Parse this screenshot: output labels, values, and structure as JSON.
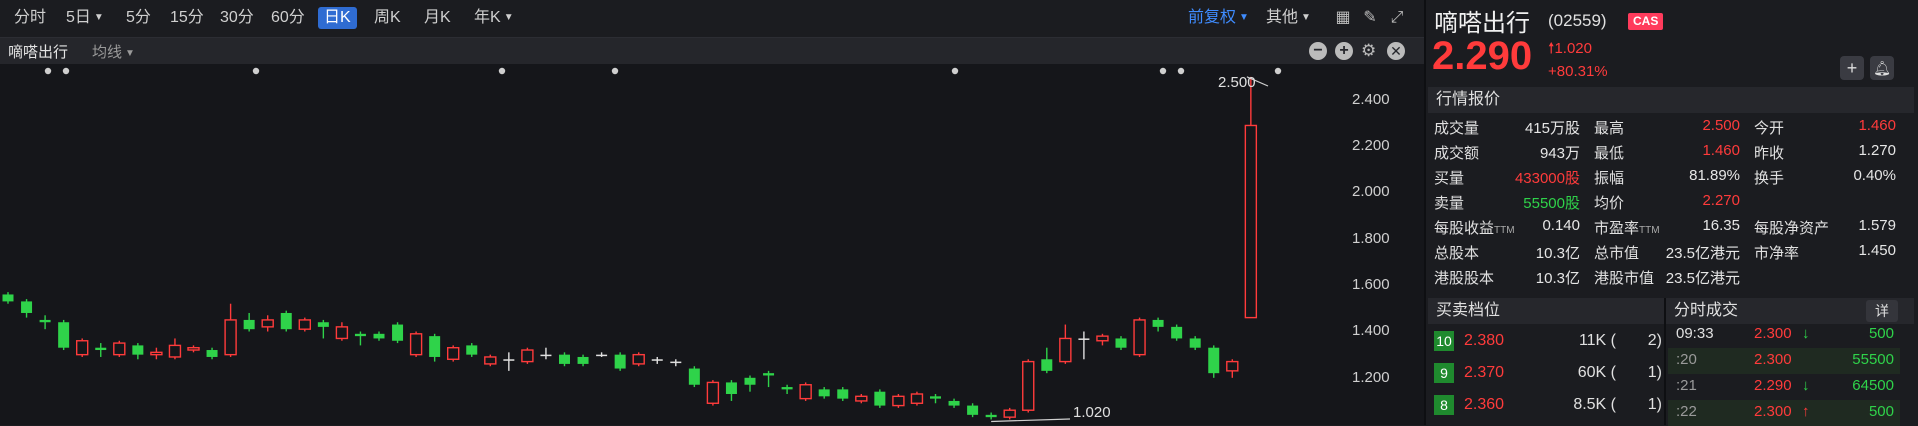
{
  "toolbar": {
    "periods": [
      "分时",
      "5日",
      "5分",
      "15分",
      "30分",
      "60分",
      "日K",
      "周K",
      "月K",
      "年K"
    ],
    "active_period": "日K",
    "adjust": "前复权",
    "other": "其他"
  },
  "subbar": {
    "stock_name": "嘀嗒出行",
    "indicator": "均线"
  },
  "chart": {
    "high_label": "2.500",
    "low_label": "1.020",
    "y_ticks": [
      "2.400",
      "2.200",
      "2.000",
      "1.800",
      "1.600",
      "1.400",
      "1.200"
    ]
  },
  "chart_data": {
    "type": "candlestick",
    "y_ticks": [
      2.4,
      2.2,
      2.0,
      1.8,
      1.6,
      1.4,
      1.2
    ],
    "ylim": [
      1.0,
      2.56
    ],
    "annotations": [
      {
        "label": "2.500",
        "value": 2.5
      },
      {
        "label": "1.020",
        "value": 1.02
      }
    ],
    "candles": [
      {
        "o": 1.56,
        "c": 1.53,
        "h": 1.57,
        "l": 1.52
      },
      {
        "o": 1.53,
        "c": 1.48,
        "h": 1.54,
        "l": 1.46
      },
      {
        "o": 1.45,
        "c": 1.44,
        "h": 1.47,
        "l": 1.41
      },
      {
        "o": 1.44,
        "c": 1.33,
        "h": 1.45,
        "l": 1.32
      },
      {
        "o": 1.3,
        "c": 1.36,
        "h": 1.37,
        "l": 1.29
      },
      {
        "o": 1.33,
        "c": 1.32,
        "h": 1.35,
        "l": 1.29
      },
      {
        "o": 1.3,
        "c": 1.35,
        "h": 1.36,
        "l": 1.29
      },
      {
        "o": 1.34,
        "c": 1.3,
        "h": 1.35,
        "l": 1.28
      },
      {
        "o": 1.3,
        "c": 1.31,
        "h": 1.33,
        "l": 1.28
      },
      {
        "o": 1.29,
        "c": 1.34,
        "h": 1.37,
        "l": 1.28
      },
      {
        "o": 1.32,
        "c": 1.33,
        "h": 1.34,
        "l": 1.31
      },
      {
        "o": 1.32,
        "c": 1.29,
        "h": 1.33,
        "l": 1.28
      },
      {
        "o": 1.3,
        "c": 1.45,
        "h": 1.52,
        "l": 1.29
      },
      {
        "o": 1.45,
        "c": 1.41,
        "h": 1.48,
        "l": 1.4
      },
      {
        "o": 1.42,
        "c": 1.45,
        "h": 1.47,
        "l": 1.4
      },
      {
        "o": 1.48,
        "c": 1.41,
        "h": 1.49,
        "l": 1.4
      },
      {
        "o": 1.41,
        "c": 1.45,
        "h": 1.46,
        "l": 1.4
      },
      {
        "o": 1.44,
        "c": 1.42,
        "h": 1.45,
        "l": 1.37
      },
      {
        "o": 1.37,
        "c": 1.42,
        "h": 1.44,
        "l": 1.36
      },
      {
        "o": 1.39,
        "c": 1.38,
        "h": 1.4,
        "l": 1.34
      },
      {
        "o": 1.39,
        "c": 1.37,
        "h": 1.4,
        "l": 1.36
      },
      {
        "o": 1.43,
        "c": 1.36,
        "h": 1.44,
        "l": 1.35
      },
      {
        "o": 1.3,
        "c": 1.39,
        "h": 1.4,
        "l": 1.29
      },
      {
        "o": 1.38,
        "c": 1.29,
        "h": 1.39,
        "l": 1.27
      },
      {
        "o": 1.28,
        "c": 1.33,
        "h": 1.34,
        "l": 1.27
      },
      {
        "o": 1.34,
        "c": 1.3,
        "h": 1.35,
        "l": 1.29
      },
      {
        "o": 1.26,
        "c": 1.29,
        "h": 1.3,
        "l": 1.25
      },
      {
        "o": 1.28,
        "c": 1.28,
        "h": 1.31,
        "l": 1.23
      },
      {
        "o": 1.27,
        "c": 1.32,
        "h": 1.33,
        "l": 1.26
      },
      {
        "o": 1.3,
        "c": 1.3,
        "h": 1.33,
        "l": 1.28
      },
      {
        "o": 1.3,
        "c": 1.26,
        "h": 1.31,
        "l": 1.25
      },
      {
        "o": 1.29,
        "c": 1.26,
        "h": 1.3,
        "l": 1.25
      },
      {
        "o": 1.3,
        "c": 1.3,
        "h": 1.31,
        "l": 1.29
      },
      {
        "o": 1.3,
        "c": 1.24,
        "h": 1.31,
        "l": 1.23
      },
      {
        "o": 1.26,
        "c": 1.3,
        "h": 1.31,
        "l": 1.25
      },
      {
        "o": 1.28,
        "c": 1.28,
        "h": 1.29,
        "l": 1.26
      },
      {
        "o": 1.27,
        "c": 1.27,
        "h": 1.28,
        "l": 1.25
      },
      {
        "o": 1.24,
        "c": 1.17,
        "h": 1.25,
        "l": 1.16
      },
      {
        "o": 1.09,
        "c": 1.18,
        "h": 1.19,
        "l": 1.08
      },
      {
        "o": 1.18,
        "c": 1.13,
        "h": 1.19,
        "l": 1.1
      },
      {
        "o": 1.2,
        "c": 1.17,
        "h": 1.21,
        "l": 1.14
      },
      {
        "o": 1.22,
        "c": 1.21,
        "h": 1.23,
        "l": 1.16
      },
      {
        "o": 1.16,
        "c": 1.15,
        "h": 1.17,
        "l": 1.13
      },
      {
        "o": 1.11,
        "c": 1.17,
        "h": 1.18,
        "l": 1.1
      },
      {
        "o": 1.15,
        "c": 1.12,
        "h": 1.16,
        "l": 1.11
      },
      {
        "o": 1.15,
        "c": 1.11,
        "h": 1.16,
        "l": 1.1
      },
      {
        "o": 1.1,
        "c": 1.12,
        "h": 1.13,
        "l": 1.09
      },
      {
        "o": 1.14,
        "c": 1.08,
        "h": 1.15,
        "l": 1.07
      },
      {
        "o": 1.08,
        "c": 1.12,
        "h": 1.13,
        "l": 1.07
      },
      {
        "o": 1.09,
        "c": 1.13,
        "h": 1.14,
        "l": 1.08
      },
      {
        "o": 1.12,
        "c": 1.11,
        "h": 1.13,
        "l": 1.09
      },
      {
        "o": 1.1,
        "c": 1.08,
        "h": 1.11,
        "l": 1.07
      },
      {
        "o": 1.08,
        "c": 1.04,
        "h": 1.09,
        "l": 1.03
      },
      {
        "o": 1.04,
        "c": 1.03,
        "h": 1.05,
        "l": 1.02
      },
      {
        "o": 1.03,
        "c": 1.06,
        "h": 1.07,
        "l": 1.02
      },
      {
        "o": 1.06,
        "c": 1.27,
        "h": 1.28,
        "l": 1.05
      },
      {
        "o": 1.28,
        "c": 1.23,
        "h": 1.33,
        "l": 1.22
      },
      {
        "o": 1.27,
        "c": 1.37,
        "h": 1.43,
        "l": 1.26
      },
      {
        "o": 1.37,
        "c": 1.37,
        "h": 1.4,
        "l": 1.28
      },
      {
        "o": 1.36,
        "c": 1.38,
        "h": 1.39,
        "l": 1.34
      },
      {
        "o": 1.37,
        "c": 1.33,
        "h": 1.38,
        "l": 1.32
      },
      {
        "o": 1.3,
        "c": 1.45,
        "h": 1.46,
        "l": 1.29
      },
      {
        "o": 1.45,
        "c": 1.42,
        "h": 1.46,
        "l": 1.4
      },
      {
        "o": 1.42,
        "c": 1.37,
        "h": 1.43,
        "l": 1.36
      },
      {
        "o": 1.37,
        "c": 1.33,
        "h": 1.38,
        "l": 1.32
      },
      {
        "o": 1.33,
        "c": 1.22,
        "h": 1.34,
        "l": 1.2
      },
      {
        "o": 1.23,
        "c": 1.27,
        "h": 1.28,
        "l": 1.2
      },
      {
        "o": 1.46,
        "c": 2.29,
        "h": 2.5,
        "l": 1.46
      }
    ]
  },
  "quote": {
    "name": "嘀嗒出行",
    "code": "(02559)",
    "badge": "CAS",
    "price": "2.290",
    "change": "1.020",
    "change_pct": "+80.31%"
  },
  "market": {
    "title": "行情报价",
    "rows": [
      [
        {
          "l": "成交量",
          "v": "415万股",
          "c": ""
        },
        {
          "l": "最高",
          "v": "2.500",
          "c": "red"
        },
        {
          "l": "今开",
          "v": "1.460",
          "c": "red"
        }
      ],
      [
        {
          "l": "成交额",
          "v": "943万",
          "c": ""
        },
        {
          "l": "最低",
          "v": "1.460",
          "c": "red"
        },
        {
          "l": "昨收",
          "v": "1.270",
          "c": ""
        }
      ],
      [
        {
          "l": "买量",
          "v": "433000股",
          "c": "red"
        },
        {
          "l": "振幅",
          "v": "81.89%",
          "c": ""
        },
        {
          "l": "换手",
          "v": "0.40%",
          "c": ""
        }
      ],
      [
        {
          "l": "卖量",
          "v": "55500股",
          "c": "green"
        },
        {
          "l": "均价",
          "v": "2.270",
          "c": "red"
        },
        {
          "l": "",
          "v": "",
          "c": ""
        }
      ],
      [
        {
          "l": "每股收益",
          "s": "TTM",
          "v": "0.140",
          "c": ""
        },
        {
          "l": "市盈率",
          "s": "TTM",
          "v": "16.35",
          "c": ""
        },
        {
          "l": "每股净资产",
          "v": "1.579",
          "c": ""
        }
      ],
      [
        {
          "l": "总股本",
          "v": "10.3亿",
          "c": ""
        },
        {
          "l": "总市值",
          "v": "23.5亿港元",
          "c": ""
        },
        {
          "l": "市净率",
          "v": "1.450",
          "c": ""
        }
      ],
      [
        {
          "l": "港股股本",
          "v": "10.3亿",
          "c": ""
        },
        {
          "l": "港股市值",
          "v": "23.5亿港元",
          "c": ""
        },
        {
          "l": "",
          "v": "",
          "c": ""
        }
      ]
    ]
  },
  "orderbook": {
    "title": "买卖档位",
    "rows": [
      {
        "level": "10",
        "price": "2.380",
        "vol": "11K",
        "count": "2"
      },
      {
        "level": "9",
        "price": "2.370",
        "vol": "60K",
        "count": "1"
      },
      {
        "level": "8",
        "price": "2.360",
        "vol": "8.5K",
        "count": "1"
      }
    ]
  },
  "trades": {
    "title": "分时成交",
    "detail_btn": "详",
    "rows": [
      {
        "time": "09:33",
        "price": "2.300",
        "dir": "↓",
        "dir_c": "green",
        "vol": "500"
      },
      {
        "time": ":20",
        "price": "2.300",
        "dir": "",
        "dir_c": "",
        "vol": "55500"
      },
      {
        "time": ":21",
        "price": "2.290",
        "dir": "↓",
        "dir_c": "green",
        "vol": "64500"
      },
      {
        "time": ":22",
        "price": "2.300",
        "dir": "↑",
        "dir_c": "red",
        "vol": "500"
      }
    ]
  }
}
